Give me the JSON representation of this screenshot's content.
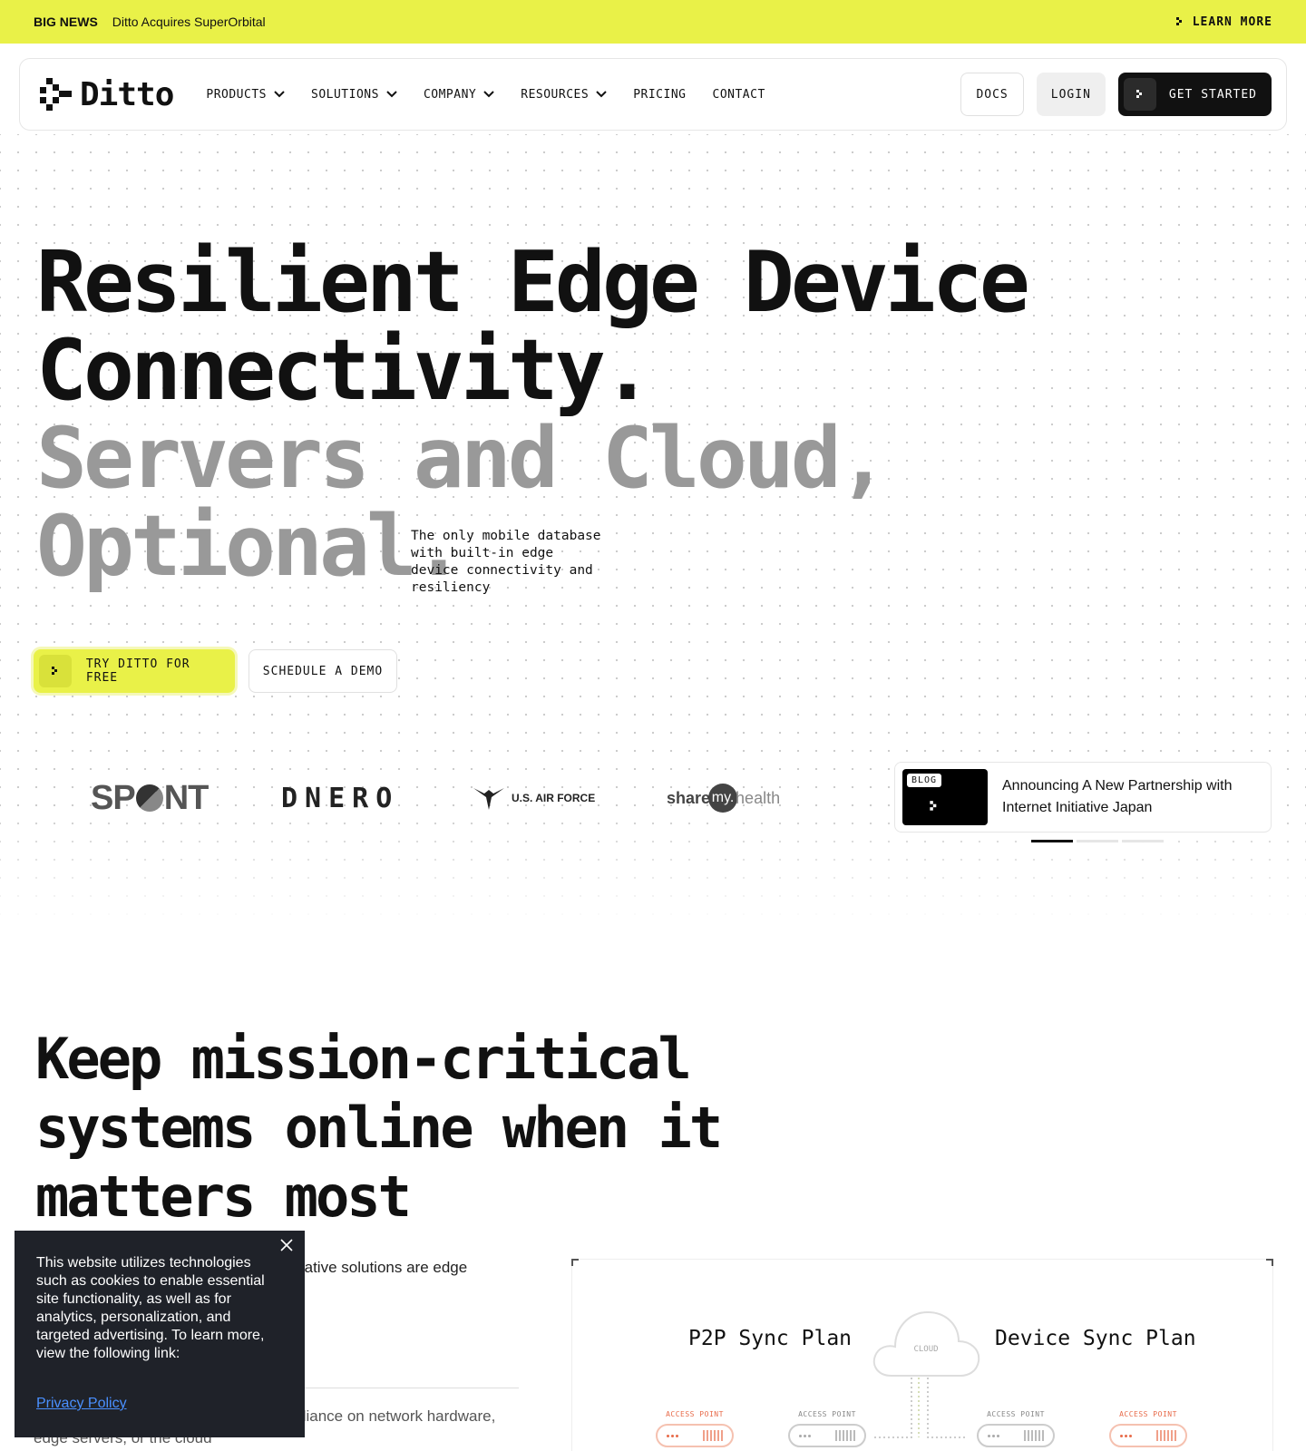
{
  "announcement": {
    "tag": "BIG NEWS",
    "message": "Ditto Acquires SuperOrbital",
    "cta": "LEARN MORE"
  },
  "nav": {
    "logo": "Ditto",
    "menu": [
      {
        "label": "PRODUCTS",
        "dropdown": true
      },
      {
        "label": "SOLUTIONS",
        "dropdown": true
      },
      {
        "label": "COMPANY",
        "dropdown": true
      },
      {
        "label": "RESOURCES",
        "dropdown": true
      },
      {
        "label": "PRICING",
        "dropdown": false
      },
      {
        "label": "CONTACT",
        "dropdown": false
      }
    ],
    "docs": "DOCS",
    "login": "LOGIN",
    "get_started": "GET STARTED"
  },
  "hero": {
    "line1": "Resilient Edge Device",
    "line2": "Connectivity.",
    "line3": "Servers and Cloud,",
    "line4": "Optional.",
    "subtitle": "The only mobile database with built-in edge device connectivity and resiliency",
    "cta_primary": "TRY DITTO FOR FREE",
    "cta_secondary": "SCHEDULE A DEMO"
  },
  "logos": {
    "spont_a": "SP",
    "spont_b": "NT",
    "dnero": "DNERO",
    "airforce": "U.S. AIR FORCE",
    "sharemy_a": "share",
    "sharemy_b": "my.",
    "sharemy_c": "health"
  },
  "blog": {
    "badge": "BLOG",
    "title": "Announcing A New Partnership with Internet Initiative Japan",
    "slides": 3,
    "active_slide": 1
  },
  "section2": {
    "title": "Keep mission-critical systems online when it matters most",
    "body": "abase that can consistently ere. Edge-native solutions are edge devices, without relying",
    "body2": "atency-sensitive and resilient without reliance on network hardware, edge servers, or the cloud"
  },
  "diagram": {
    "left_title": "P2P Sync Plan",
    "right_title": "Device Sync Plan",
    "cloud_label": "CLOUD",
    "access_points": [
      {
        "label": "ACCESS POINT",
        "style": "orange"
      },
      {
        "label": "ACCESS POINT",
        "style": "gray"
      },
      {
        "label": "ACCESS POINT",
        "style": "gray"
      },
      {
        "label": "ACCESS POINT",
        "style": "orange"
      }
    ]
  },
  "cookie": {
    "text": "This website utilizes technologies such as cookies to enable essential site functionality, as well as for analytics, personalization, and targeted advertising. To learn more, view the following link:",
    "link": "Privacy Policy"
  },
  "colors": {
    "accent": "#e9f148",
    "dark": "#111111",
    "hero_gray": "#999999",
    "orange": "#e86b4a"
  }
}
